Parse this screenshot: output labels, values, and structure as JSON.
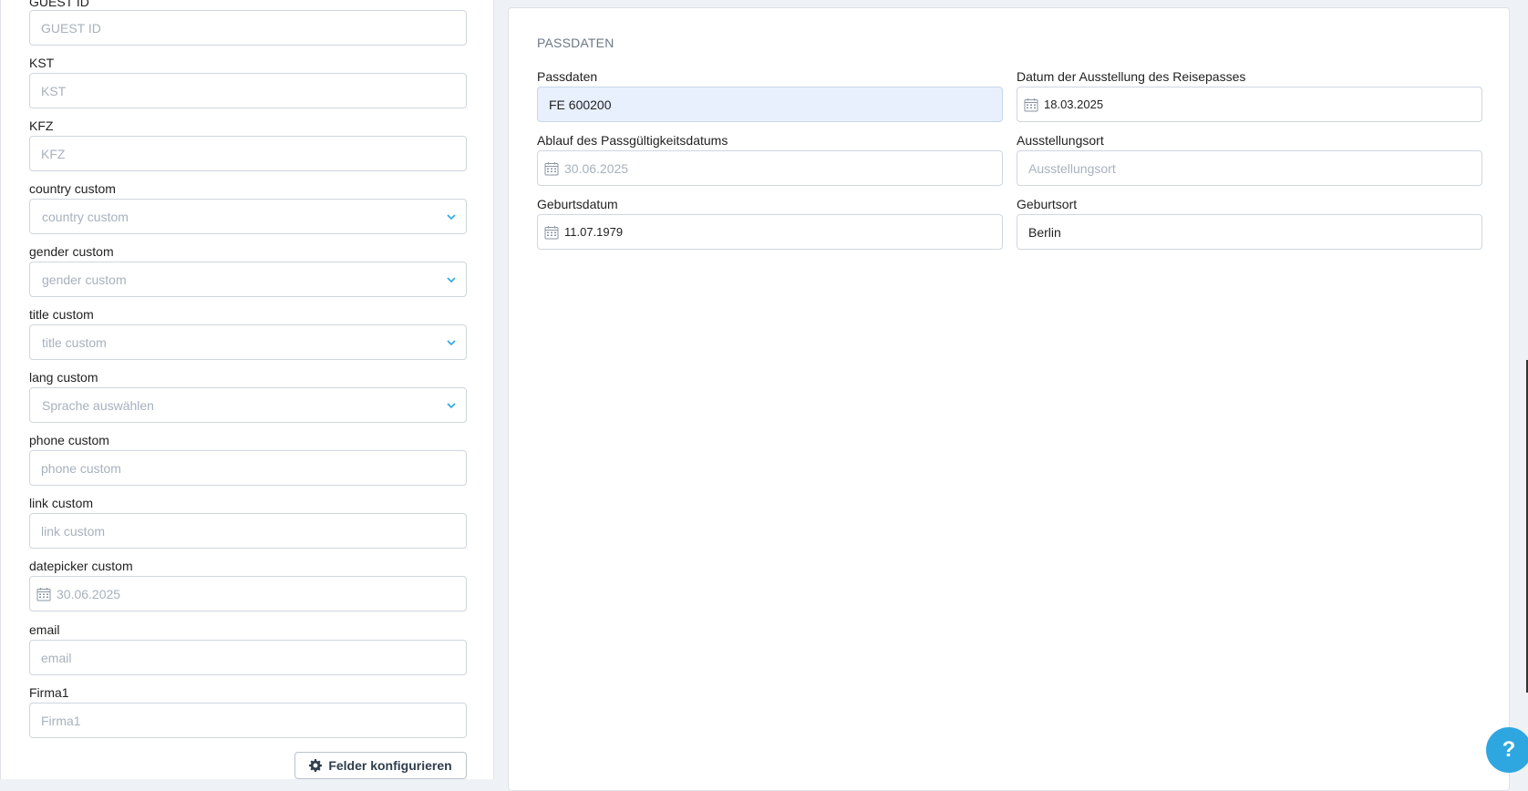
{
  "left_form": {
    "guest_id": {
      "label": "GUEST ID",
      "placeholder": "GUEST ID"
    },
    "kst": {
      "label": "KST",
      "placeholder": "KST"
    },
    "kfz": {
      "label": "KFZ",
      "placeholder": "KFZ"
    },
    "country": {
      "label": "country custom",
      "placeholder": "country custom"
    },
    "gender": {
      "label": "gender custom",
      "placeholder": "gender custom"
    },
    "title": {
      "label": "title custom",
      "placeholder": "title custom"
    },
    "lang": {
      "label": "lang custom",
      "placeholder": "Sprache auswählen"
    },
    "phone": {
      "label": "phone custom",
      "placeholder": "phone custom"
    },
    "link": {
      "label": "link custom",
      "placeholder": "link custom"
    },
    "datepicker": {
      "label": "datepicker custom",
      "placeholder": "30.06.2025"
    },
    "email": {
      "label": "email",
      "placeholder": "email"
    },
    "firma": {
      "label": "Firma1",
      "placeholder": "Firma1"
    },
    "configure_button": "Felder konfigurieren"
  },
  "passport": {
    "section_title": "PASSDATEN",
    "passdaten": {
      "label": "Passdaten",
      "value": "FE 600200"
    },
    "issue_date": {
      "label": "Datum der Ausstellung des Reisepasses",
      "value": "18.03.2025"
    },
    "expiry": {
      "label": "Ablauf des Passgültigkeitsdatums",
      "placeholder": "30.06.2025"
    },
    "issue_place": {
      "label": "Ausstellungsort",
      "placeholder": "Ausstellungsort"
    },
    "birth_date": {
      "label": "Geburtsdatum",
      "value": "11.07.1979"
    },
    "birth_place": {
      "label": "Geburtsort",
      "value": "Berlin"
    }
  },
  "help": {
    "label": "?"
  },
  "colors": {
    "accent": "#2ea7e0",
    "highlight": "#e8f0fe",
    "border": "#cfd6de"
  }
}
